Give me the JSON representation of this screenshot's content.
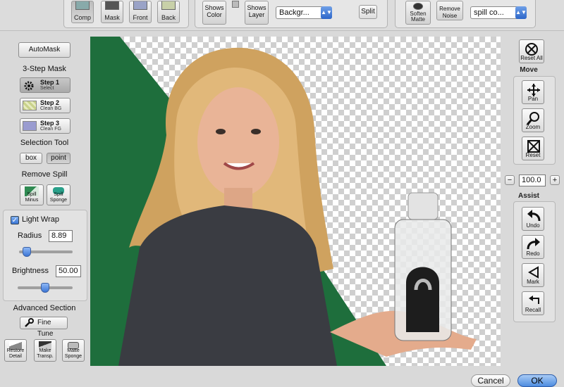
{
  "toolbar": {
    "view_buttons": [
      {
        "label": "Comp",
        "icon": "composite-view-icon"
      },
      {
        "label": "Mask",
        "icon": "mask-view-icon"
      },
      {
        "label": "Front",
        "icon": "front-view-icon"
      },
      {
        "label": "Back",
        "icon": "back-view-icon"
      }
    ],
    "shows_color_label": "Shows Color",
    "shows_layer_label": "Shows Layer",
    "background_select": "Backgr...",
    "split_label": "Split",
    "soften_matte_label": "Soften Matte",
    "remove_noise_label": "Remove Noise",
    "spill_select": "spill co..."
  },
  "left": {
    "automask_label": "AutoMask",
    "three_step_title": "3-Step Mask",
    "steps": [
      {
        "title": "Step 1",
        "subtitle": "Select",
        "icon": "gear-icon"
      },
      {
        "title": "Step 2",
        "subtitle": "Clean BG",
        "icon": "clean-bg-icon"
      },
      {
        "title": "Step 3",
        "subtitle": "Clean FG",
        "icon": "clean-fg-icon"
      }
    ],
    "selection_tool_title": "Selection Tool",
    "box_label": "box",
    "point_label": "point",
    "remove_spill_title": "Remove Spill",
    "spill_minus_label": "Spill Minus",
    "spill_sponge_label": "Spill Sponge",
    "light_wrap_label": "Light Wrap",
    "light_wrap_checked": true,
    "radius_label": "Radius",
    "radius_value": "8.89",
    "radius_slider_fraction": 0.15,
    "brightness_label": "Brightness",
    "brightness_value": "50.00",
    "brightness_slider_fraction": 0.5,
    "advanced_title": "Advanced Section",
    "fine_tune_label": "Fine Tune",
    "bottom_buttons": [
      {
        "label": "Restore Detail",
        "icon": "restore-detail-icon"
      },
      {
        "label": "Make Transp.",
        "icon": "make-transparent-icon"
      },
      {
        "label": "Matte Sponge",
        "icon": "matte-sponge-icon"
      }
    ]
  },
  "right": {
    "reset_all_label": "Reset All",
    "move_title": "Move",
    "pan_label": "Pan",
    "zoom_label": "Zoom",
    "reset_label": "Reset",
    "zoom_minus": "−",
    "zoom_value": "100.0",
    "zoom_plus": "+",
    "assist_title": "Assist",
    "undo_label": "Undo",
    "redo_label": "Redo",
    "mark_label": "Mark",
    "recall_label": "Recall"
  },
  "footer": {
    "cancel_label": "Cancel",
    "ok_label": "OK"
  },
  "colors": {
    "green_screen": "#1e6e3c",
    "accent_blue": "#3b76d6"
  }
}
